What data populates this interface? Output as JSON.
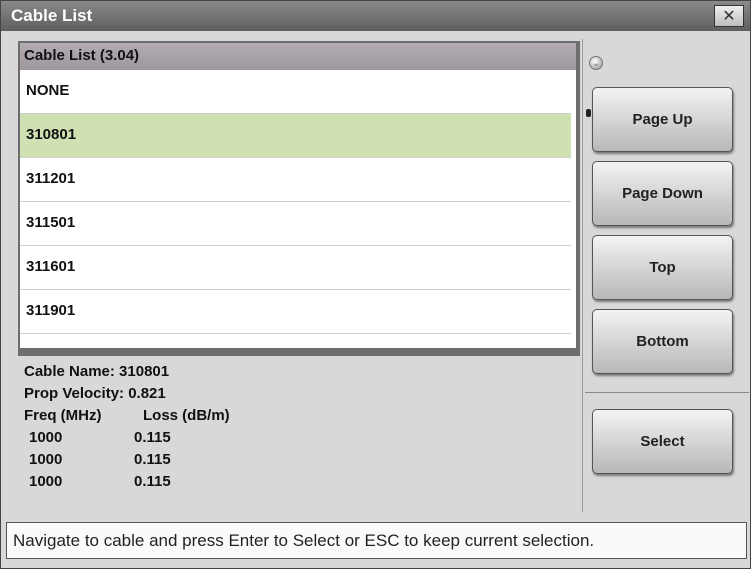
{
  "window": {
    "title": "Cable List",
    "close_label": "✕"
  },
  "list": {
    "header": "Cable List (3.04)",
    "items": [
      "NONE",
      "310801",
      "311201",
      "311501",
      "311601",
      "311901"
    ],
    "selected": "310801"
  },
  "details": {
    "cable_name_label": "Cable Name:",
    "cable_name": "310801",
    "prop_velocity_label": "Prop Velocity:",
    "prop_velocity": "0.821",
    "freq_header": "Freq (MHz)",
    "loss_header": "Loss (dB/m)",
    "rows": [
      {
        "freq": "1000",
        "loss": "0.115"
      },
      {
        "freq": "1000",
        "loss": "0.115"
      },
      {
        "freq": "1000",
        "loss": "0.115"
      }
    ]
  },
  "buttons": {
    "page_up": "Page Up",
    "page_down": "Page Down",
    "top": "Top",
    "bottom": "Bottom",
    "select": "Select"
  },
  "indicator": {
    "icon": "chevron-down-icon",
    "glyph": "⌄"
  },
  "status": "Navigate to cable and press Enter to Select or ESC to keep current selection.",
  "colors": {
    "selected_row": "#cfe0b2",
    "titlebar": "#6e6e6e",
    "list_header": "#aaa2a9"
  }
}
